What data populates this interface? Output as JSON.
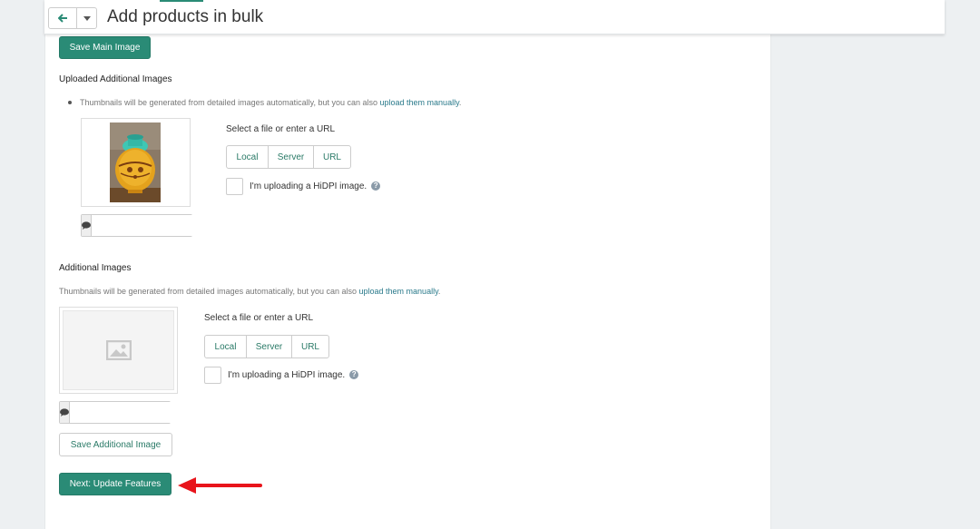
{
  "header": {
    "title": "Add products in bulk",
    "back_icon": "arrow-left-icon",
    "menu_icon": "caret-down-icon"
  },
  "main_image": {
    "save_label": "Save Main Image"
  },
  "uploaded_additional": {
    "heading": "Uploaded Additional Images",
    "hint_text": "Thumbnails will be generated from detailed images automatically, but you can also ",
    "hint_link": "upload them manually",
    "hint_end": ".",
    "image_alt": "decorative vase image",
    "select_label": "Select a file or enter a URL",
    "sources": [
      "Local",
      "Server",
      "URL"
    ],
    "hidpi_label": "I'm uploading a HiDPI image.",
    "comment_icon": "comment-icon"
  },
  "additional": {
    "heading": "Additional Images",
    "hint_text": "Thumbnails will be generated from detailed images automatically, but you can also ",
    "hint_link": "upload them manually",
    "hint_end": ".",
    "placeholder_icon": "image-placeholder-icon",
    "select_label": "Select a file or enter a URL",
    "sources": [
      "Local",
      "Server",
      "URL"
    ],
    "hidpi_label": "I'm uploading a HiDPI image.",
    "save_label": "Save Additional Image"
  },
  "footer": {
    "next_label": "Next: Update Features"
  },
  "colors": {
    "accent": "#2a8b76",
    "link": "#2a7a8b",
    "arrow": "#e8141b",
    "page_bg": "#edf0f2"
  }
}
